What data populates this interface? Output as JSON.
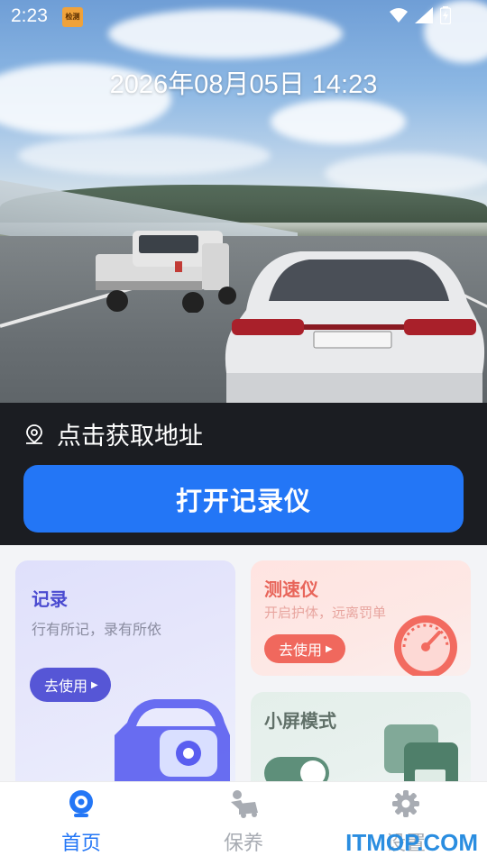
{
  "status_bar": {
    "time": "2:23",
    "app_icon_text": "检测"
  },
  "hero": {
    "datetime": "2026年08月05日 14:23"
  },
  "address": {
    "label": "点击获取地址",
    "icon": "location-pin-icon"
  },
  "open_button": {
    "label": "打开记录仪"
  },
  "cards": {
    "record": {
      "title": "记录",
      "subtitle": "行有所记，录有所依",
      "button": "去使用",
      "title_color": "#4a4ad0",
      "button_color": "#5656d6"
    },
    "speed": {
      "title": "测速仪",
      "subtitle": "开启护体，远离罚单",
      "button": "去使用",
      "title_color": "#e8655a",
      "button_color": "#f0685d"
    },
    "small_screen": {
      "title": "小屏模式",
      "title_color": "#607068"
    }
  },
  "nav": {
    "items": [
      {
        "label": "首页",
        "icon": "camera-icon",
        "active": true
      },
      {
        "label": "保养",
        "icon": "car-maintenance-icon",
        "active": false
      },
      {
        "label": "设置",
        "icon": "gear-icon",
        "active": false
      }
    ],
    "active_color": "#2376f6",
    "inactive_color": "#a8acb3"
  },
  "watermark": "ITMOP.COM",
  "colors": {
    "accent": "#2376f6",
    "dark_panel": "#1b1d22"
  }
}
